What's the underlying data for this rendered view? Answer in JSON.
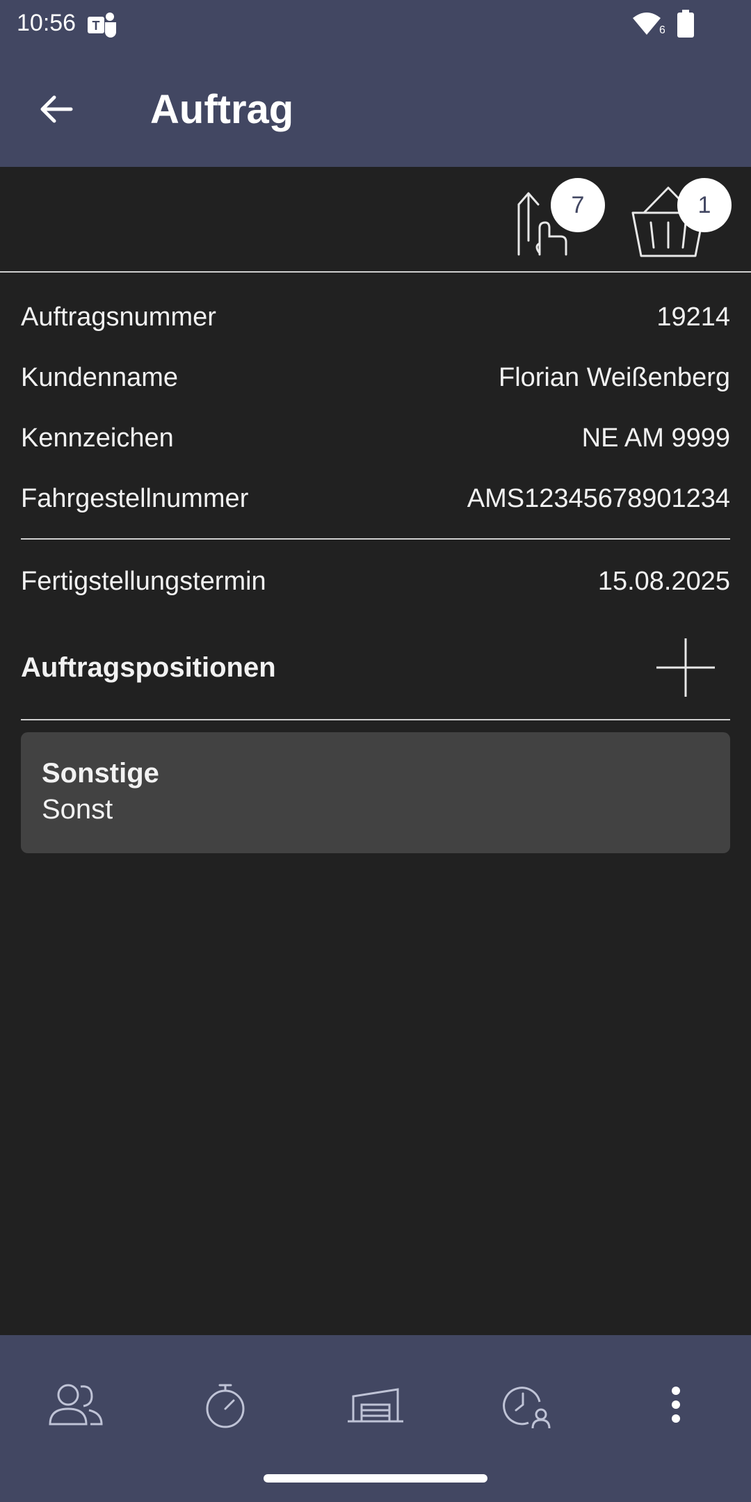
{
  "status_bar": {
    "time": "10:56",
    "wifi_badge": "6",
    "icons": [
      "teams-icon",
      "wifi-icon",
      "battery-icon"
    ]
  },
  "app_bar": {
    "title": "Auftrag",
    "back_icon": "arrow-left-icon"
  },
  "toolbar": {
    "upload": {
      "icon": "upload-hand-icon",
      "badge": "7"
    },
    "basket": {
      "icon": "basket-icon",
      "badge": "1"
    }
  },
  "order": {
    "rows": [
      {
        "label": "Auftragsnummer",
        "value": "19214"
      },
      {
        "label": "Kundenname",
        "value": "Florian Weißenberg"
      },
      {
        "label": "Kennzeichen",
        "value": "NE AM 9999"
      },
      {
        "label": "Fahrgestellnummer",
        "value": "AMS12345678901234"
      }
    ],
    "deadline": {
      "label": "Fertigstellungstermin",
      "value": "15.08.2025"
    }
  },
  "positions": {
    "title": "Auftragspositionen",
    "add_icon": "plus-icon",
    "items": [
      {
        "title": "Sonstige",
        "subtitle": "Sonst"
      }
    ]
  },
  "bottom_nav": {
    "items": [
      "customers-icon",
      "stopwatch-icon",
      "garage-icon",
      "time-user-icon",
      "more-vertical-icon"
    ]
  },
  "colors": {
    "primary": "#424762",
    "background": "#212121",
    "card": "#424242",
    "text": "#f2f2f2"
  }
}
